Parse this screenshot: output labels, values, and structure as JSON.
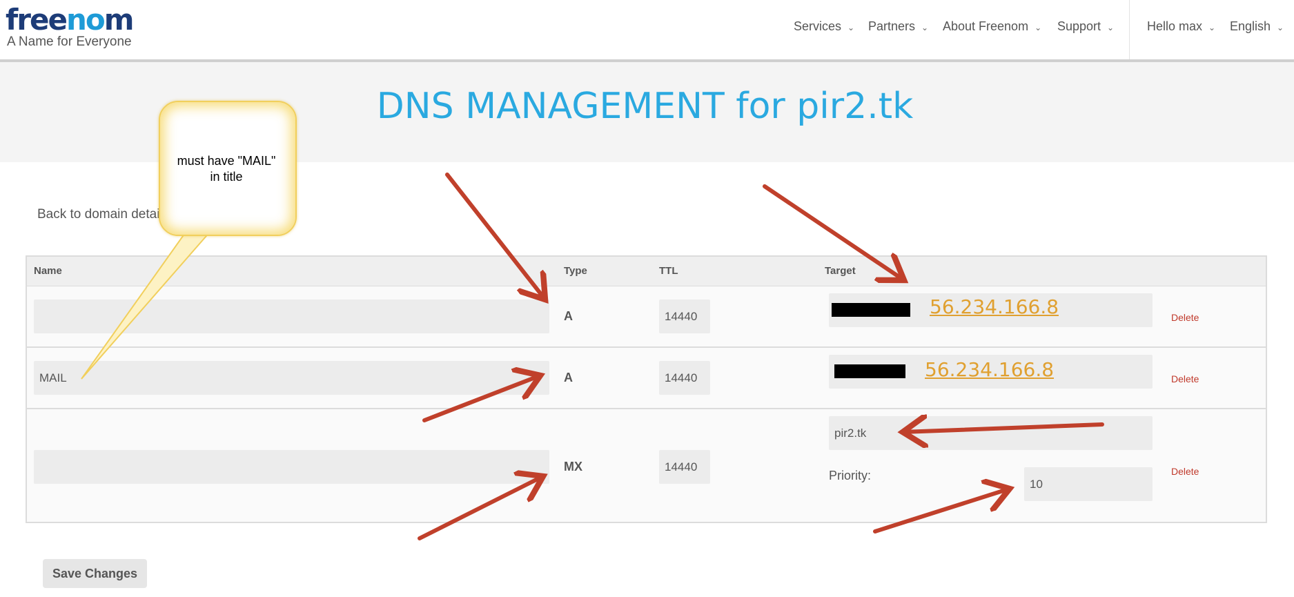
{
  "brand": {
    "logo_prefix": "free",
    "logo_oo": "no",
    "logo_suffix": "m",
    "tagline": "A Name for Everyone"
  },
  "nav": {
    "items": [
      {
        "label": "Services"
      },
      {
        "label": "Partners"
      },
      {
        "label": "About Freenom"
      },
      {
        "label": "Support"
      },
      {
        "label": "Hello max"
      },
      {
        "label": "English"
      }
    ]
  },
  "page": {
    "title": "DNS MANAGEMENT for pir2.tk",
    "back_link": "Back to domain detail"
  },
  "table": {
    "headers": {
      "name": "Name",
      "type": "Type",
      "ttl": "TTL",
      "target": "Target"
    },
    "rows": [
      {
        "name": "",
        "type": "A",
        "ttl": "14440",
        "target": "56.234.166.8",
        "delete": "Delete"
      },
      {
        "name": "MAIL",
        "type": "A",
        "ttl": "14440",
        "target": "56.234.166.8",
        "delete": "Delete"
      },
      {
        "name": "",
        "type": "MX",
        "ttl": "14440",
        "target": "pir2.tk",
        "priority_label": "Priority:",
        "priority": "10",
        "delete": "Delete"
      }
    ]
  },
  "actions": {
    "save_label": "Save Changes"
  },
  "annotation": {
    "callout_line1": "must have \"MAIL\"",
    "callout_line2": "in title"
  },
  "colors": {
    "title_blue": "#2aa9e0",
    "logo_dark": "#1d3c78",
    "logo_light": "#1e9bd7",
    "ip_orange": "#e0a030",
    "delete_red": "#c0392b",
    "arrow_red": "#c0402b",
    "callout_yellow": "#f1cf5c"
  }
}
